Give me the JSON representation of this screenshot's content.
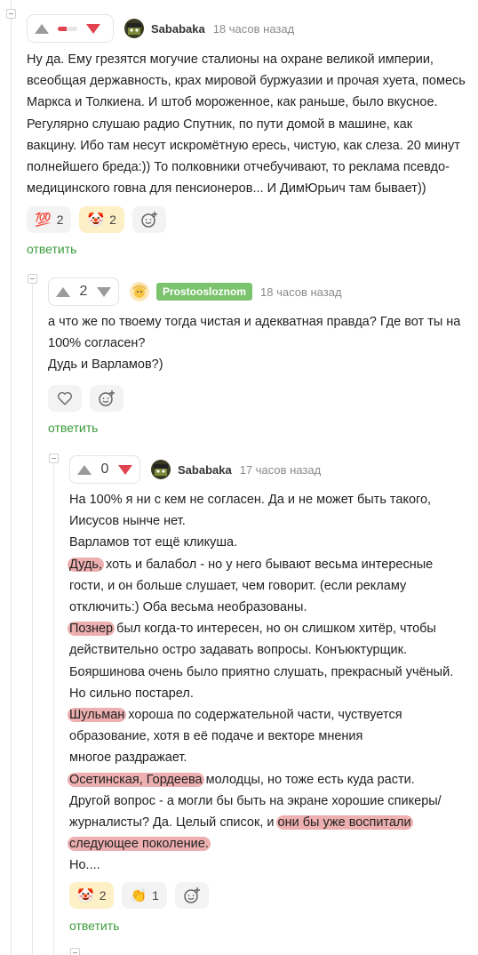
{
  "comments": [
    {
      "author": "Sababaka",
      "time": "18 часов назад",
      "score": "",
      "reply": "ответить",
      "lines": [
        "Ну да. Ему грезятся могучие сталионы на охране великой империи,",
        "всеобщая державность, крах мировой буржуазии и прочая хуета, помесь",
        "Маркса и Толкиена. И штоб мороженное, как раньше, было вкусное.",
        "Регулярно слушаю радио Спутник, по пути домой в машине, как",
        "вакцину. Ибо там несут искромётную ересь, чистую, как слеза. 20 минут",
        "полнейшего бреда:)) То полковники отчебучивают, то реклама псевдо-",
        "медицинского говна для пенсионеров... И ДимЮрьич там бывает))"
      ],
      "reactions": [
        {
          "icon": "hundred-points-icon",
          "glyph": "💯",
          "count": "2"
        },
        {
          "icon": "clown-face-icon",
          "glyph": "🤡",
          "count": "2"
        }
      ]
    },
    {
      "author": "Prostoosloznom",
      "time": "18 часов назад",
      "score": "2",
      "reply": "ответить",
      "lines": [
        "а что же по твоему тогда чистая и адекватная правда? Где вот ты на",
        "100% согласен?",
        "Дудь и Варламов?)"
      ]
    },
    {
      "author": "Sababaka",
      "time": "17 часов назад",
      "score": "0",
      "reply": "ответить",
      "lines": [
        [
          "На 100% я ни с кем не согласен. Да и не может быть такого,"
        ],
        [
          "Иисусов нынче нет."
        ],
        [
          "Варламов тот ещё кликуша."
        ],
        [
          {
            "hl": "Дудь,"
          },
          " хоть и балабол - но у него бывают весьма интересные"
        ],
        [
          "гости, и он больше слушает, чем говорит. (если рекламу"
        ],
        [
          "отключить:) Оба весьма необразованы."
        ],
        [
          {
            "hl": "Познер"
          },
          " был когда-то интересен, но он слишком хитёр, чтобы"
        ],
        [
          "действительно остро задавать вопросы. Конъюктурщик."
        ],
        [
          "Бояршинова очень было приятно слушать, прекрасный учёный."
        ],
        [
          "Но сильно постарел."
        ],
        [
          {
            "hl": "Шульман"
          },
          " хороша по содержательной части, чуствуется"
        ],
        [
          "образование, хотя в её подаче и векторе мнения"
        ],
        [
          "многое раздражает."
        ],
        [
          {
            "hl": "Осетинская, Гордеева"
          },
          " молодцы, но тоже есть куда расти."
        ],
        [
          "Другой вопрос - а могли бы быть на экране хорошие спикеры/"
        ],
        [
          "журналисты? Да. Целый список, и ",
          {
            "hl": "они бы уже воспитали"
          }
        ],
        [
          {
            "hl": "следующее поколение."
          }
        ],
        [
          "Но...."
        ]
      ],
      "reactions": [
        {
          "icon": "clown-face-icon",
          "glyph": "🤡",
          "count": "2"
        },
        {
          "icon": "clapping-hands-icon",
          "glyph": "👏",
          "count": "1"
        }
      ]
    }
  ],
  "colors": {
    "downvote": "#e0434f",
    "reply_link": "#3a9b3a",
    "author_badge": "#7cc36e",
    "highlight": "#de6e6e"
  }
}
